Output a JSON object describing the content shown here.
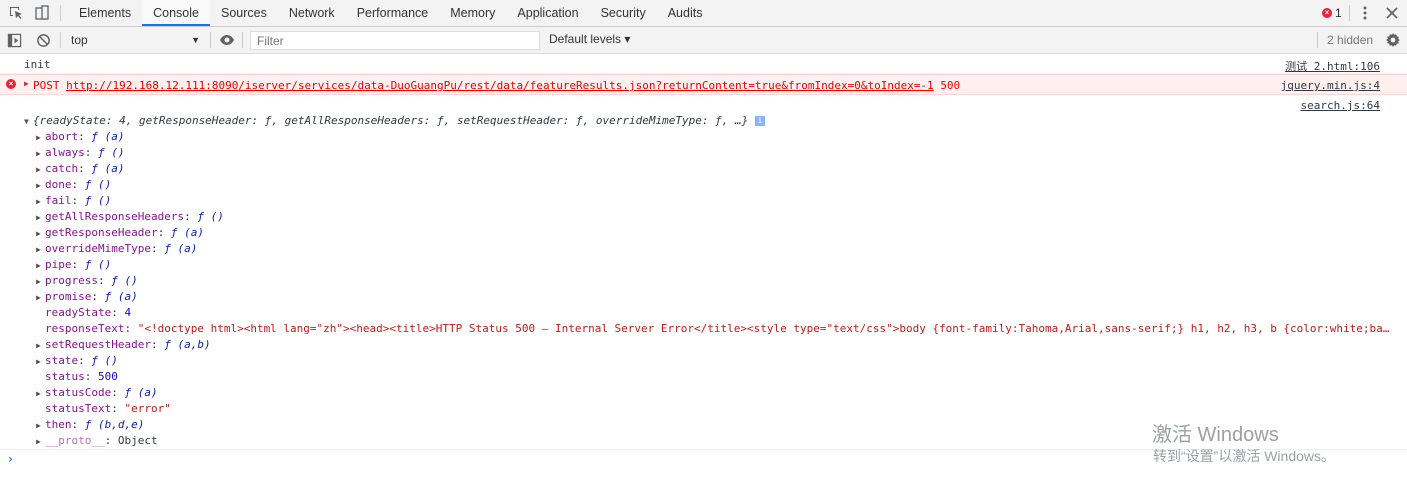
{
  "tabs": [
    "Elements",
    "Console",
    "Sources",
    "Network",
    "Performance",
    "Memory",
    "Application",
    "Security",
    "Audits"
  ],
  "active_tab": "Console",
  "error_count": "1",
  "toolbar": {
    "context": "top",
    "filter_placeholder": "Filter",
    "levels_label": "Default levels ▾",
    "hidden_label": "2 hidden"
  },
  "messages": {
    "init": {
      "text": "init",
      "source": "测试 2.html:106"
    },
    "error": {
      "method": "POST",
      "url": "http://192.168.12.111:8090/iserver/services/data-DuoGuangPu/rest/data/featureResults.json?returnContent=true&fromIndex=0&toIndex=-1",
      "status": "500",
      "source": "jquery.min.js:4"
    },
    "obj_source": "search.js:64",
    "obj_summary": "{readyState: 4, getResponseHeader: ƒ, getAllResponseHeaders: ƒ, setRequestHeader: ƒ, overrideMimeType: ƒ, …}"
  },
  "props": [
    {
      "key": "abort",
      "value": "ƒ (a)",
      "type": "fn",
      "expand": true
    },
    {
      "key": "always",
      "value": "ƒ ()",
      "type": "fn",
      "expand": true
    },
    {
      "key": "catch",
      "value": "ƒ (a)",
      "type": "fn",
      "expand": true
    },
    {
      "key": "done",
      "value": "ƒ ()",
      "type": "fn",
      "expand": true
    },
    {
      "key": "fail",
      "value": "ƒ ()",
      "type": "fn",
      "expand": true
    },
    {
      "key": "getAllResponseHeaders",
      "value": "ƒ ()",
      "type": "fn",
      "expand": true
    },
    {
      "key": "getResponseHeader",
      "value": "ƒ (a)",
      "type": "fn",
      "expand": true
    },
    {
      "key": "overrideMimeType",
      "value": "ƒ (a)",
      "type": "fn",
      "expand": true
    },
    {
      "key": "pipe",
      "value": "ƒ ()",
      "type": "fn",
      "expand": true
    },
    {
      "key": "progress",
      "value": "ƒ ()",
      "type": "fn",
      "expand": true
    },
    {
      "key": "promise",
      "value": "ƒ (a)",
      "type": "fn",
      "expand": true
    },
    {
      "key": "readyState",
      "value": "4",
      "type": "num",
      "expand": false
    },
    {
      "key": "responseText",
      "value": "\"<!doctype html><html lang=\"zh\"><head><title>HTTP Status 500 – Internal Server Error</title><style type=\"text/css\">body {font-family:Tahoma,Arial,sans-serif;} h1, h2, h3, b {color:white;ba…",
      "type": "str",
      "expand": false
    },
    {
      "key": "setRequestHeader",
      "value": "ƒ (a,b)",
      "type": "fn",
      "expand": true
    },
    {
      "key": "state",
      "value": "ƒ ()",
      "type": "fn",
      "expand": true
    },
    {
      "key": "status",
      "value": "500",
      "type": "num",
      "expand": false
    },
    {
      "key": "statusCode",
      "value": "ƒ (a)",
      "type": "fn",
      "expand": true
    },
    {
      "key": "statusText",
      "value": "\"error\"",
      "type": "str",
      "expand": false
    },
    {
      "key": "then",
      "value": "ƒ (b,d,e)",
      "type": "fn",
      "expand": true
    },
    {
      "key": "__proto__",
      "value": "Object",
      "type": "obj",
      "expand": true,
      "dim": true
    }
  ],
  "watermark": {
    "line1": "激活 Windows",
    "line2": "转到“设置”以激活 Windows。"
  }
}
